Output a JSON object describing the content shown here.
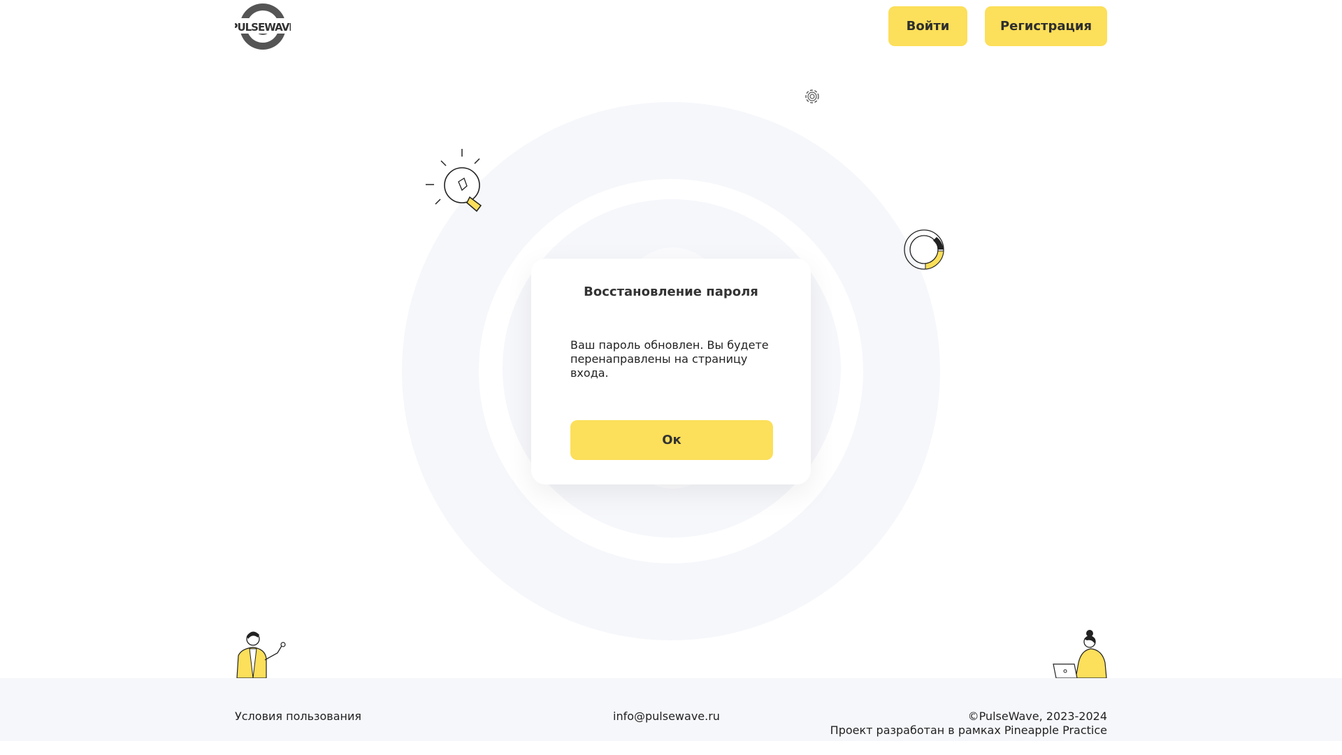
{
  "header": {
    "logo_text": "PULSEWAVE",
    "login_label": "Войти",
    "register_label": "Регистрация"
  },
  "modal": {
    "title": "Восстановление пароля",
    "message": "Ваш пароль обновлен. Вы будете перенаправлены на страницу входа.",
    "ok_label": "Ок"
  },
  "footer": {
    "terms_label": "Условия пользования",
    "email": "info@pulsewave.ru",
    "copyright": "©PulseWave, 2023-2024",
    "project_note": "Проект разработан в рамках Pineapple Practice"
  },
  "colors": {
    "accent": "#fcdf5a",
    "background_ring": "#f6f7fb",
    "footer_bg": "#f6f7fb",
    "text": "#222222"
  },
  "icons": [
    "pulsewave-logo",
    "gear-icon",
    "lightbulb-icon",
    "donut-chart-icon",
    "person-waving-illustration",
    "woman-laptop-illustration"
  ]
}
